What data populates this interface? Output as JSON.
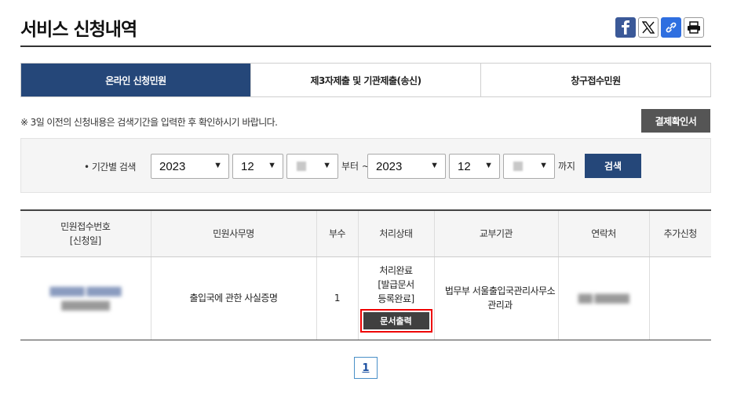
{
  "page": {
    "title": "서비스 신청내역"
  },
  "share": {
    "icons": [
      "facebook-icon",
      "x-icon",
      "link-icon",
      "print-icon"
    ]
  },
  "tabs": [
    {
      "label": "온라인 신청민원",
      "active": true
    },
    {
      "label": "제3자제출 및 기관제출(송신)",
      "active": false
    },
    {
      "label": "창구접수민원",
      "active": false
    }
  ],
  "notice": "※ 3일 이전의 신청내용은 검색기간을 입력한 후 확인하시기 바랍니다.",
  "pay_button": "결제확인서",
  "search": {
    "label": "• 기간별 검색",
    "from_year": "2023",
    "from_month": "12",
    "from_suffix": "부터 ~",
    "to_year": "2023",
    "to_month": "12",
    "to_suffix": "까지",
    "button": "검색"
  },
  "table": {
    "headers": [
      "민원접수번호\n[신청일]",
      "민원사무명",
      "부수",
      "처리상태",
      "교부기관",
      "연락처",
      "추가신청"
    ],
    "header_line1": "민원접수번호",
    "header_line2": "[신청일]",
    "header_name": "민원사무명",
    "header_count": "부수",
    "header_status": "처리상태",
    "header_agency": "교부기관",
    "header_contact": "연락처",
    "header_extra": "추가신청",
    "rows": [
      {
        "receipt_no": "",
        "service_name": "출입국에 관한 사실증명",
        "count": "1",
        "status_line1": "처리완료",
        "status_line2": "[발급문서",
        "status_line3": "등록완료]",
        "print_button": "문서출력",
        "agency": "법무부 서울출입국관리사무소 관리과",
        "contact": "",
        "extra": ""
      }
    ]
  },
  "pagination": {
    "current": "1"
  },
  "colors": {
    "primary": "#254779",
    "highlight": "#e00000",
    "dark_button": "#404040"
  }
}
